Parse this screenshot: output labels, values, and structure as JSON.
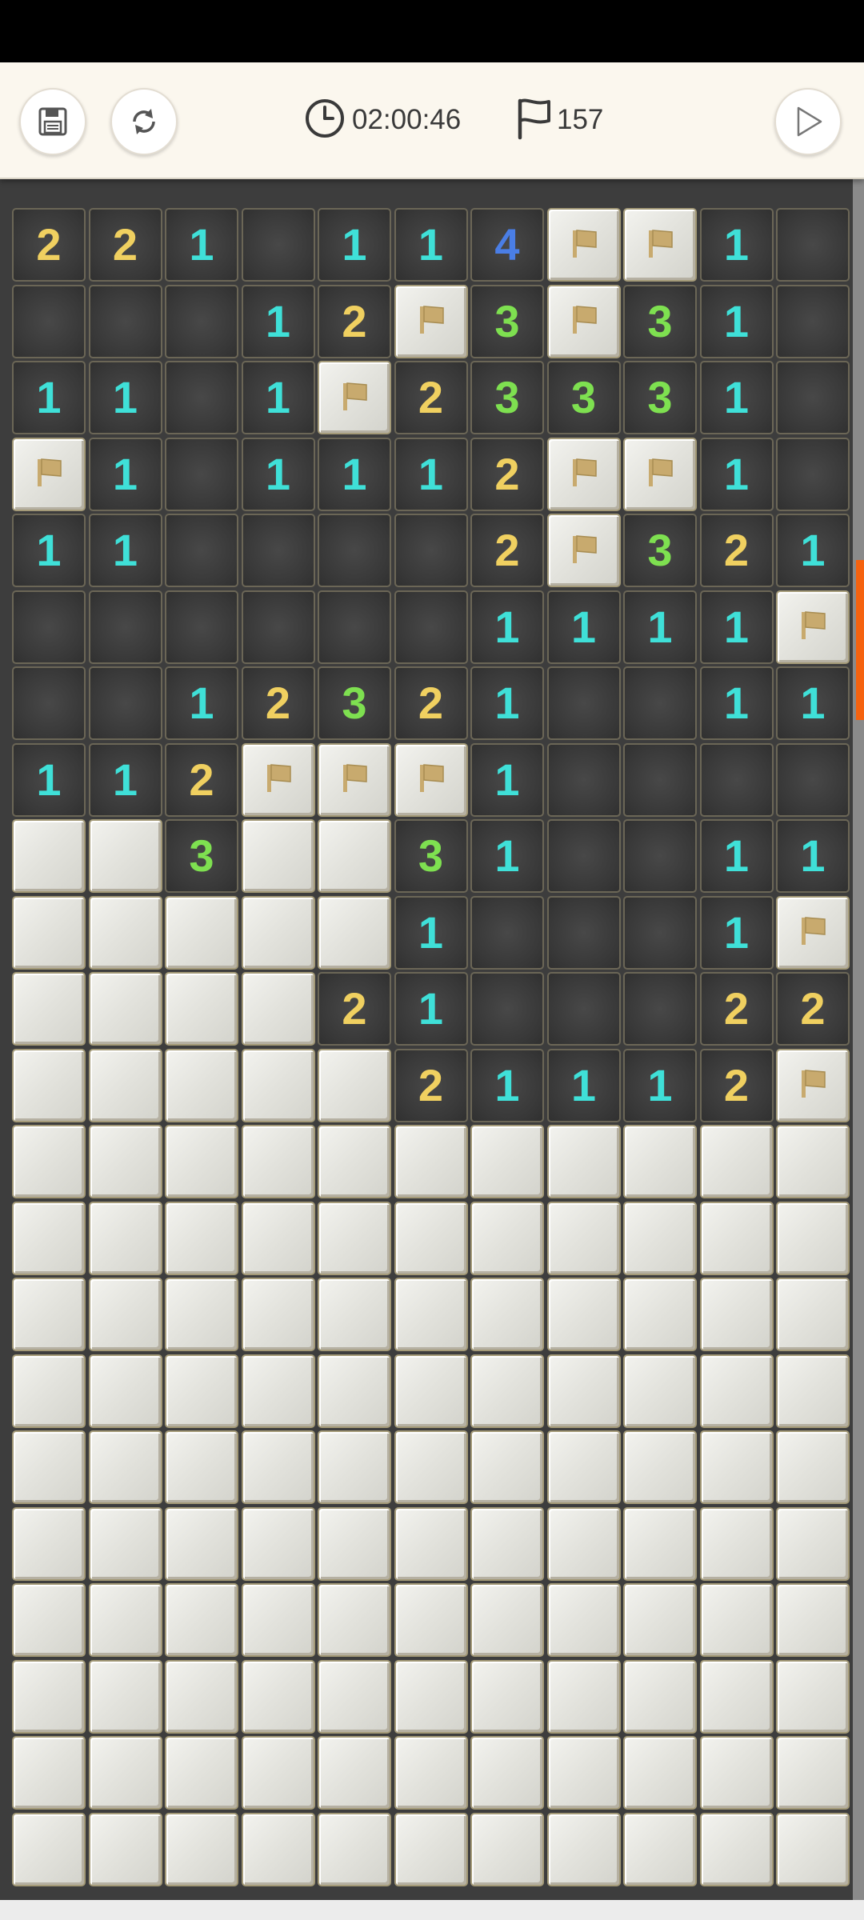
{
  "toolbar": {
    "timer": "02:00:46",
    "flags_remaining": "157",
    "icons": {
      "save": "save-icon",
      "restart": "restart-icon",
      "clock": "clock-icon",
      "flag": "flag-icon",
      "play": "play-icon"
    }
  },
  "colors": {
    "number_1": "#3fe0d8",
    "number_2": "#f0d060",
    "number_3": "#7ee050",
    "number_4": "#4a7ee6",
    "flag": "#c8aa6e",
    "scroll_indicator": "#f5620f"
  },
  "board": {
    "columns": 11,
    "legend": {
      "#": "covered",
      ".": "revealed empty",
      "F": "flag",
      "1-8": "revealed number"
    },
    "rows": [
      "2 2 1 . 1 1 4 F F 1 .",
      ". . . 1 2 F 3 F 3 1 .",
      "1 1 . 1 F 2 3 3 3 1 .",
      "F 1 . 1 1 1 2 F F 1 .",
      "1 1 . . . . 2 F 3 2 1",
      ". . . . . . 1 1 1 1 F",
      ". . 1 2 3 2 1 . . 1 1",
      "1 1 2 F F F 1 . . . .",
      "# # 3 # # 3 1 . . 1 1",
      "# # # # # 1 . . . 1 F",
      "# # # # 2 1 . . . 2 2",
      "# # # # # 2 1 1 1 2 F",
      "# # # # # # # # # # #",
      "# # # # # # # # # # #",
      "# # # # # # # # # # #",
      "# # # # # # # # # # #",
      "# # # # # # # # # # #",
      "# # # # # # # # # # #",
      "# # # # # # # # # # #",
      "# # # # # # # # # # #",
      "# # # # # # # # # # #",
      "# # # # # # # # # # #"
    ]
  }
}
